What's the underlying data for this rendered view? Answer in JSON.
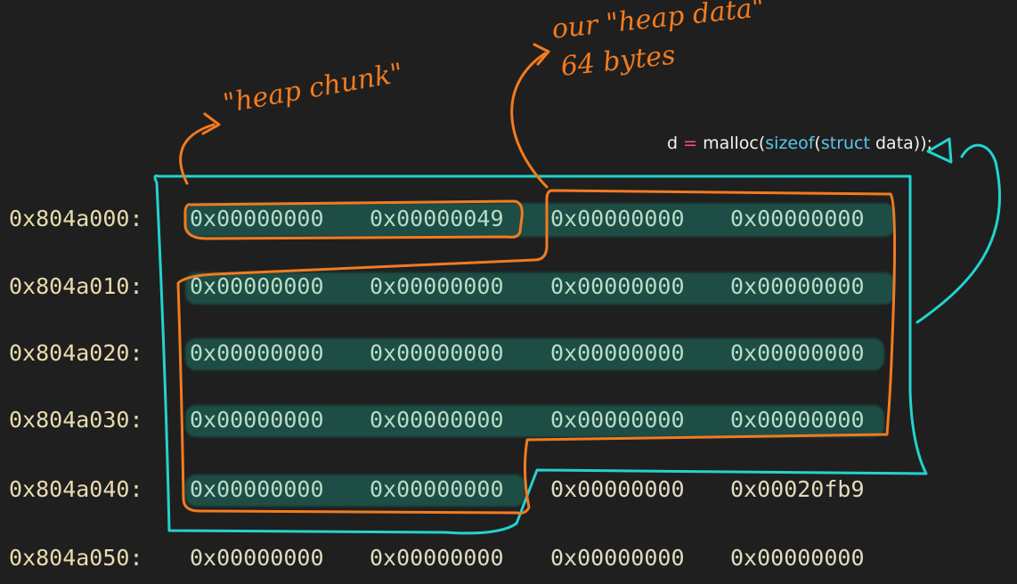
{
  "memory_dump": {
    "rows": [
      {
        "address": "0x804a000:",
        "words": [
          "0x00000000",
          "0x00000049",
          "0x00000000",
          "0x00000000"
        ]
      },
      {
        "address": "0x804a010:",
        "words": [
          "0x00000000",
          "0x00000000",
          "0x00000000",
          "0x00000000"
        ]
      },
      {
        "address": "0x804a020:",
        "words": [
          "0x00000000",
          "0x00000000",
          "0x00000000",
          "0x00000000"
        ]
      },
      {
        "address": "0x804a030:",
        "words": [
          "0x00000000",
          "0x00000000",
          "0x00000000",
          "0x00000000"
        ]
      },
      {
        "address": "0x804a040:",
        "words": [
          "0x00000000",
          "0x00000000",
          "0x00000000",
          "0x00020fb9"
        ]
      },
      {
        "address": "0x804a050:",
        "words": [
          "0x00000000",
          "0x00000000",
          "0x00000000",
          "0x00000000"
        ]
      }
    ]
  },
  "code": {
    "var": "d",
    "assign": " = ",
    "func": "malloc(",
    "sizeof": "sizeof",
    "paren_open": "(",
    "struct_kw": "struct",
    "type_rest": " data));"
  },
  "annotations": {
    "heap_chunk": "\"heap chunk\"",
    "heap_data_line1": "our \"heap data\"",
    "heap_data_line2": "64 bytes"
  },
  "colors": {
    "background": "#1f1f1f",
    "address": "#e8dcae",
    "word": "#b8dcc8",
    "highlight": "#1d5046",
    "orange_ink": "#f27b1f",
    "cyan_ink": "#22d3cf",
    "keyword": "#5cc7ea",
    "operator": "#ff4f8b"
  }
}
